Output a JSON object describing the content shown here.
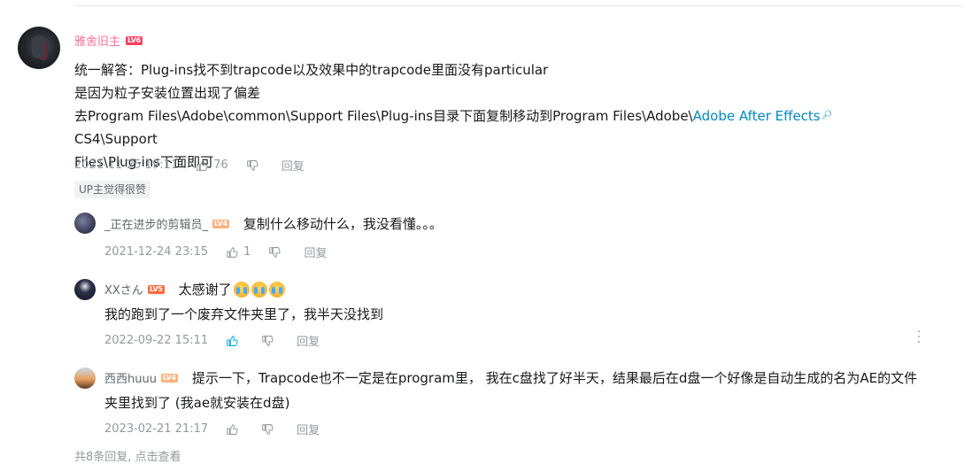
{
  "main_comment": {
    "username": "雅舍旧主",
    "level": "LV6",
    "lines": [
      "统一解答：Plug-ins找不到trapcode以及效果中的trapcode里面没有particular",
      "是因为粒子安装位置出现了偏差"
    ],
    "line3_prefix": "去Program Files\\Adobe\\common\\Support Files\\Plug-ins目录下面复制移动到Program Files\\Adobe\\",
    "line3_link": "Adobe After Effects",
    "line3_suffix": " CS4\\Support",
    "line4": "Files\\Plug-ins下面即可",
    "time": "2021-11-25 19:11",
    "likes": "76",
    "reply_label": "回复",
    "up_badge": "UP主觉得很赞"
  },
  "replies": [
    {
      "username": "_正在进步的剪辑员_",
      "level": "LV4",
      "text": "复制什么移动什么，我没看懂。。。",
      "time": "2021-12-24 23:15",
      "likes": "1",
      "reply_label": "回复"
    },
    {
      "username": "XXさん",
      "level": "LV5",
      "text": "太感谢了",
      "emoji": [
        "crying-emoji",
        "crying-emoji",
        "crying-emoji"
      ],
      "text2": "我的跑到了一个废弃文件夹里了，我半天没找到",
      "time": "2022-09-22 15:11",
      "likes": "",
      "reply_label": "回复"
    },
    {
      "username": "西西huuu",
      "level": "LV4",
      "text": "提示一下，Trapcode也不一定是在program里， 我在c盘找了好半天，结果最后在d盘一个好像是自动生成的名为AE的文件",
      "text2": "夹里找到了  (我ae就安装在d盘)",
      "time": "2023-02-21 21:17",
      "likes": "",
      "reply_label": "回复"
    }
  ],
  "view_more": "共8条回复, 点击查看",
  "colors": {
    "username_pink": "#fb7299",
    "link_blue": "#008ac5",
    "meta_gray": "#9499a0",
    "liked_blue": "#00aeec"
  }
}
